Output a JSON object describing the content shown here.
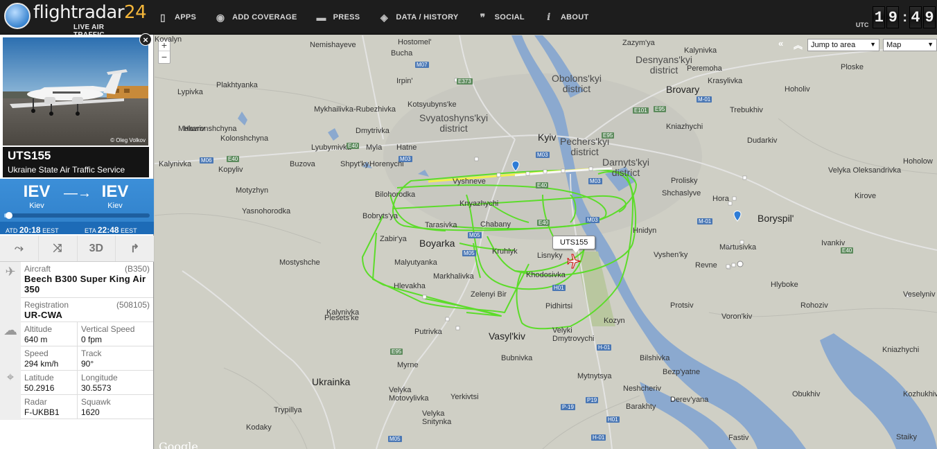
{
  "header": {
    "logo_main": "flightradar",
    "logo_num": "24",
    "logo_sub": "LIVE AIR TRAFFIC",
    "nav": [
      {
        "label": "APPS",
        "icon": "phone-icon",
        "glyph": "▯"
      },
      {
        "label": "ADD COVERAGE",
        "icon": "eye-icon",
        "glyph": "◉"
      },
      {
        "label": "PRESS",
        "icon": "chat-icon",
        "glyph": "▬"
      },
      {
        "label": "DATA / HISTORY",
        "icon": "box-icon",
        "glyph": "◈"
      },
      {
        "label": "SOCIAL",
        "icon": "quote-icon",
        "glyph": "❞"
      },
      {
        "label": "ABOUT",
        "icon": "info-icon",
        "glyph": "i"
      }
    ],
    "clock": {
      "utc": "UTC",
      "h1": "1",
      "h2": "9",
      "sep": ":",
      "m1": "4",
      "m2": "9"
    }
  },
  "panel": {
    "close": "×",
    "photo_credit": "© Oleg Volkov",
    "callsign": "UTS155",
    "airline": "Ukraine State Air Traffic Service",
    "origin_code": "IEV",
    "origin_city": "Kiev",
    "dest_code": "IEV",
    "dest_city": "Kiev",
    "arrow": "—→",
    "progress": 0.02,
    "atd_label": "ATD",
    "atd": "20:18",
    "atd_tz": "EEST",
    "eta_label": "ETA",
    "eta": "22:48",
    "eta_tz": "EEST",
    "tools": [
      {
        "name": "route-tool-icon",
        "glyph": "⤳"
      },
      {
        "name": "collapse-icon",
        "glyph": "⤨"
      },
      {
        "name": "3d-view-button",
        "glyph": "3D"
      },
      {
        "name": "share-icon",
        "glyph": "↱"
      }
    ],
    "aircraft_label": "Aircraft",
    "aircraft_code": "(B350)",
    "aircraft": "Beech B300 Super King Air 350",
    "registration_label": "Registration",
    "registration_code": "(508105)",
    "registration": "UR-CWA",
    "altitude_label": "Altitude",
    "altitude": "640 m",
    "vspeed_label": "Vertical Speed",
    "vspeed": "0 fpm",
    "speed_label": "Speed",
    "speed": "294 km/h",
    "track_label": "Track",
    "track": "90°",
    "lat_label": "Latitude",
    "lat": "50.2916",
    "lon_label": "Longitude",
    "lon": "30.5573",
    "radar_label": "Radar",
    "radar": "F-UKBB1",
    "squawk_label": "Squawk",
    "squawk": "1620"
  },
  "map": {
    "zoom_in": "+",
    "zoom_out": "−",
    "jump": "Jump to area",
    "map_type": "Map",
    "flight_label": "UTS155",
    "google": "Google",
    "places": [
      {
        "t": "Nemishayeve",
        "c": "place"
      },
      {
        "t": "Hostomel'",
        "c": "place"
      },
      {
        "t": "Bucha",
        "c": "place"
      },
      {
        "t": "Irpin'",
        "c": "place"
      },
      {
        "t": "Obolons'kyi\ndistrict",
        "c": "place district"
      },
      {
        "t": "Desnyans'kyi\ndistrict",
        "c": "place district"
      },
      {
        "t": "Zazym'ya",
        "c": "place"
      },
      {
        "t": "Kalynivka",
        "c": "place"
      },
      {
        "t": "Peremoha",
        "c": "place"
      },
      {
        "t": "Ploske",
        "c": "place"
      },
      {
        "t": "Krasylivka",
        "c": "place"
      },
      {
        "t": "Hoholiv",
        "c": "place"
      },
      {
        "t": "Brovary",
        "c": "place city"
      },
      {
        "t": "Plakhtyanka",
        "c": "place"
      },
      {
        "t": "Lypivka",
        "c": "place"
      },
      {
        "t": "Mykhailivka-Rubezhivka",
        "c": "place"
      },
      {
        "t": "Kotsyubyns'ke",
        "c": "place"
      },
      {
        "t": "Svyatoshyns'kyi\ndistrict",
        "c": "place district"
      },
      {
        "t": "Trebukhiv",
        "c": "place"
      },
      {
        "t": "Havronshchyna",
        "c": "place"
      },
      {
        "t": "Makariv",
        "c": "place"
      },
      {
        "t": "Kniazhychi",
        "c": "place"
      },
      {
        "t": "Dmytrivka",
        "c": "place"
      },
      {
        "t": "Kyiv",
        "c": "place city"
      },
      {
        "t": "Dudarkiv",
        "c": "place"
      },
      {
        "t": "Kolonshchyna",
        "c": "place"
      },
      {
        "t": "Lyubymivka",
        "c": "place"
      },
      {
        "t": "Myla",
        "c": "place"
      },
      {
        "t": "Hatne",
        "c": "place"
      },
      {
        "t": "Pechers'kyi\ndistrict",
        "c": "place district"
      },
      {
        "t": "Darnyts'kyi\ndistrict",
        "c": "place district"
      },
      {
        "t": "Kalynivka",
        "c": "place"
      },
      {
        "t": "Kopyliv",
        "c": "place"
      },
      {
        "t": "Buzova",
        "c": "place"
      },
      {
        "t": "Shpyt'ky",
        "c": "place"
      },
      {
        "t": "Horenychi",
        "c": "place"
      },
      {
        "t": "Vyshneve",
        "c": "place"
      },
      {
        "t": "Prolisky",
        "c": "place"
      },
      {
        "t": "Velyka Oleksandrivka",
        "c": "place"
      },
      {
        "t": "Hoholow",
        "c": "place"
      },
      {
        "t": "Motyzhyn",
        "c": "place"
      },
      {
        "t": "Bilohorodka",
        "c": "place"
      },
      {
        "t": "Shchaslyve",
        "c": "place"
      },
      {
        "t": "Kirove",
        "c": "place"
      },
      {
        "t": "Hora",
        "c": "place"
      },
      {
        "t": "Yasnohorodka",
        "c": "place"
      },
      {
        "t": "Bobryts'ya",
        "c": "place"
      },
      {
        "t": "Knyazhychi",
        "c": "place"
      },
      {
        "t": "Chabany",
        "c": "place"
      },
      {
        "t": "Tarasivka",
        "c": "place"
      },
      {
        "t": "Hnidyn",
        "c": "place"
      },
      {
        "t": "Boryspil'",
        "c": "place city"
      },
      {
        "t": "Zabir'ya",
        "c": "place"
      },
      {
        "t": "Boyarka",
        "c": "place city"
      },
      {
        "t": "Kruhlyk",
        "c": "place"
      },
      {
        "t": "Lisnyky",
        "c": "place"
      },
      {
        "t": "Martusivka",
        "c": "place"
      },
      {
        "t": "Ivankiv",
        "c": "place"
      },
      {
        "t": "Vyshen'ky",
        "c": "place"
      },
      {
        "t": "Mostyshche",
        "c": "place"
      },
      {
        "t": "Malyutyanka",
        "c": "place"
      },
      {
        "t": "Revne",
        "c": "place"
      },
      {
        "t": "Markhalivka",
        "c": "place"
      },
      {
        "t": "Khodosivka",
        "c": "place"
      },
      {
        "t": "Hlyboke",
        "c": "place"
      },
      {
        "t": "Hlevakha",
        "c": "place"
      },
      {
        "t": "Zelenyi Bir",
        "c": "place"
      },
      {
        "t": "Pidhirtsi",
        "c": "place"
      },
      {
        "t": "Protsiv",
        "c": "place"
      },
      {
        "t": "Rohoziv",
        "c": "place"
      },
      {
        "t": "Veselyniv",
        "c": "place"
      },
      {
        "t": "Kalynivka",
        "c": "place"
      },
      {
        "t": "Plesets'ke",
        "c": "place"
      },
      {
        "t": "Kozyn",
        "c": "place"
      },
      {
        "t": "Voron'kiv",
        "c": "place"
      },
      {
        "t": "Putrivka",
        "c": "place"
      },
      {
        "t": "Velyki\nDmytrovychi",
        "c": "place"
      },
      {
        "t": "Vasyl'kiv",
        "c": "place city"
      },
      {
        "t": "Bubnivka",
        "c": "place"
      },
      {
        "t": "Bilshivka",
        "c": "place"
      },
      {
        "t": "Kniazhychi",
        "c": "place"
      },
      {
        "t": "Myrne",
        "c": "place"
      },
      {
        "t": "Bezp'yatne",
        "c": "place"
      },
      {
        "t": "Ukrainka",
        "c": "place city"
      },
      {
        "t": "Velyka\nMotovylivka",
        "c": "place"
      },
      {
        "t": "Mytnytsya",
        "c": "place"
      },
      {
        "t": "Neshcheriv",
        "c": "place"
      },
      {
        "t": "Obukhiv",
        "c": "place"
      },
      {
        "t": "Kozhukhivka",
        "c": "place"
      },
      {
        "t": "Yerkivtsi",
        "c": "place"
      },
      {
        "t": "Barakhty",
        "c": "place"
      },
      {
        "t": "Derev'yana",
        "c": "place"
      },
      {
        "t": "Trypillya",
        "c": "place"
      },
      {
        "t": "Velyka\nSnitynka",
        "c": "place"
      },
      {
        "t": "Kodaky",
        "c": "place"
      },
      {
        "t": "Fastiv",
        "c": "place"
      },
      {
        "t": "Staiky",
        "c": "place"
      },
      {
        "t": "Kovalyn",
        "c": "place"
      }
    ],
    "roads": [
      {
        "t": "M07",
        "c": "rd b"
      },
      {
        "t": "E373",
        "c": "rd"
      },
      {
        "t": "E101",
        "c": "rd"
      },
      {
        "t": "E95",
        "c": "rd"
      },
      {
        "t": "M-01",
        "c": "rd b"
      },
      {
        "t": "M03",
        "c": "rd b"
      },
      {
        "t": "E95",
        "c": "rd"
      },
      {
        "t": "E40",
        "c": "rd"
      },
      {
        "t": "M06",
        "c": "rd b"
      },
      {
        "t": "E40",
        "c": "rd"
      },
      {
        "t": "M03",
        "c": "rd b"
      },
      {
        "t": "E40",
        "c": "rd"
      },
      {
        "t": "M03",
        "c": "rd b"
      },
      {
        "t": "M05",
        "c": "rd b"
      },
      {
        "t": "M05",
        "c": "rd b"
      },
      {
        "t": "H01",
        "c": "rd b"
      },
      {
        "t": "E40",
        "c": "rd"
      },
      {
        "t": "M03",
        "c": "rd b"
      },
      {
        "t": "E95",
        "c": "rd"
      },
      {
        "t": "H-01",
        "c": "rd b"
      },
      {
        "t": "P19",
        "c": "rd b"
      },
      {
        "t": "P-19",
        "c": "rd b"
      },
      {
        "t": "H01",
        "c": "rd b"
      },
      {
        "t": "H-01",
        "c": "rd b"
      },
      {
        "t": "M05",
        "c": "rd b"
      },
      {
        "t": "M-01",
        "c": "rd b"
      },
      {
        "t": "E40",
        "c": "rd"
      }
    ]
  }
}
